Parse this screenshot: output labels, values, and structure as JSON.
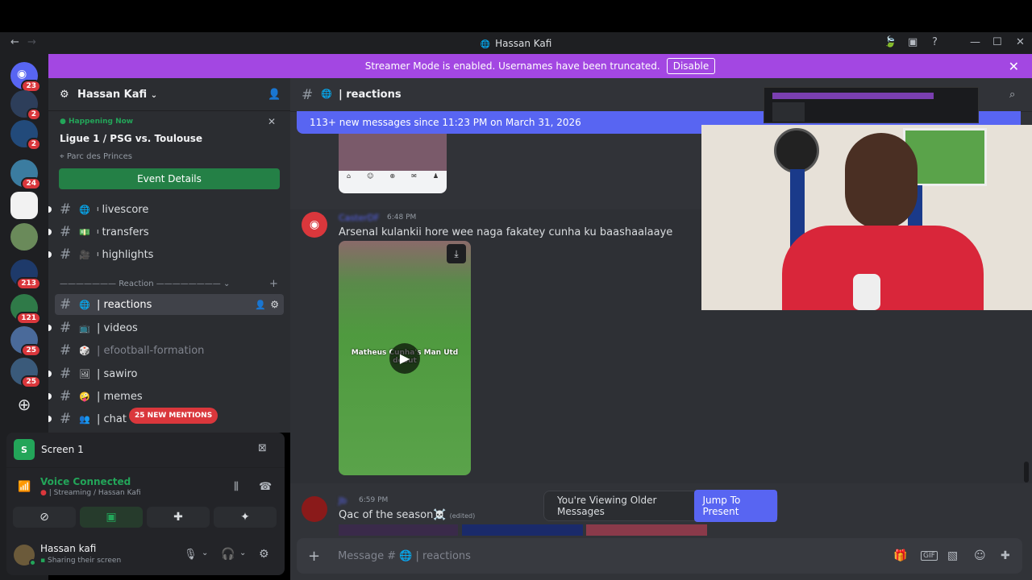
{
  "window": {
    "title": "Hassan Kafi"
  },
  "banner": {
    "text": "Streamer Mode is enabled. Usernames have been truncated.",
    "button": "Disable"
  },
  "guilds": {
    "badges": [
      "23",
      "2",
      "2",
      "24",
      "213",
      "121",
      "25",
      "25"
    ]
  },
  "server": {
    "name": "Hassan Kafi"
  },
  "event": {
    "status": "Happening Now",
    "title": "Ligue 1 / PSG vs. Toulouse",
    "location": "Parc des Princes",
    "button": "Event Details"
  },
  "channels": [
    {
      "name": "livescore",
      "emoji": "🌐"
    },
    {
      "name": "transfers",
      "emoji": "💵"
    },
    {
      "name": "highlights",
      "emoji": "🎥"
    }
  ],
  "category": {
    "name": "Reaction"
  },
  "reaction_channels": [
    {
      "name": "| reactions",
      "emoji": "🌐"
    },
    {
      "name": "| videos",
      "emoji": "📺"
    },
    {
      "name": "| efootball-formation",
      "emoji": "🎲"
    },
    {
      "name": "| sawiro",
      "emoji": "🖼"
    },
    {
      "name": "| memes",
      "emoji": "🤪"
    },
    {
      "name": "| chat",
      "emoji": "👥"
    }
  ],
  "mentions": {
    "text": "25 NEW MENTIONS"
  },
  "panel": {
    "screen": "Screen 1",
    "voice_status": "Voice Connected",
    "voice_sub": "| Streaming / Hassan Kafi",
    "user": "Hassan kafi",
    "user_status": "Sharing their screen"
  },
  "header": {
    "channel": "| reactions"
  },
  "newbar": {
    "text": "113+ new messages since 11:23 PM on March 31, 2026"
  },
  "messages": [
    {
      "author": "CasterDF",
      "time": "6:48 PM",
      "text": "Arsenal kulankii hore wee naga fakatey cunha ku baashaalaaye",
      "video_caption": "Matheus Cunha's Man Utd debut"
    },
    {
      "author": "Jb",
      "time": "6:59 PM",
      "text": "Qac of the season☠️",
      "edited": "(edited)"
    }
  ],
  "pill": {
    "text": "You're Viewing Older Messages",
    "button": "Jump To Present"
  },
  "input": {
    "placeholder": "Message # 🌐 | reactions"
  },
  "colors": {
    "accent": "#5865f2",
    "banner": "#a347e2",
    "green": "#23a559",
    "red": "#da373c"
  }
}
